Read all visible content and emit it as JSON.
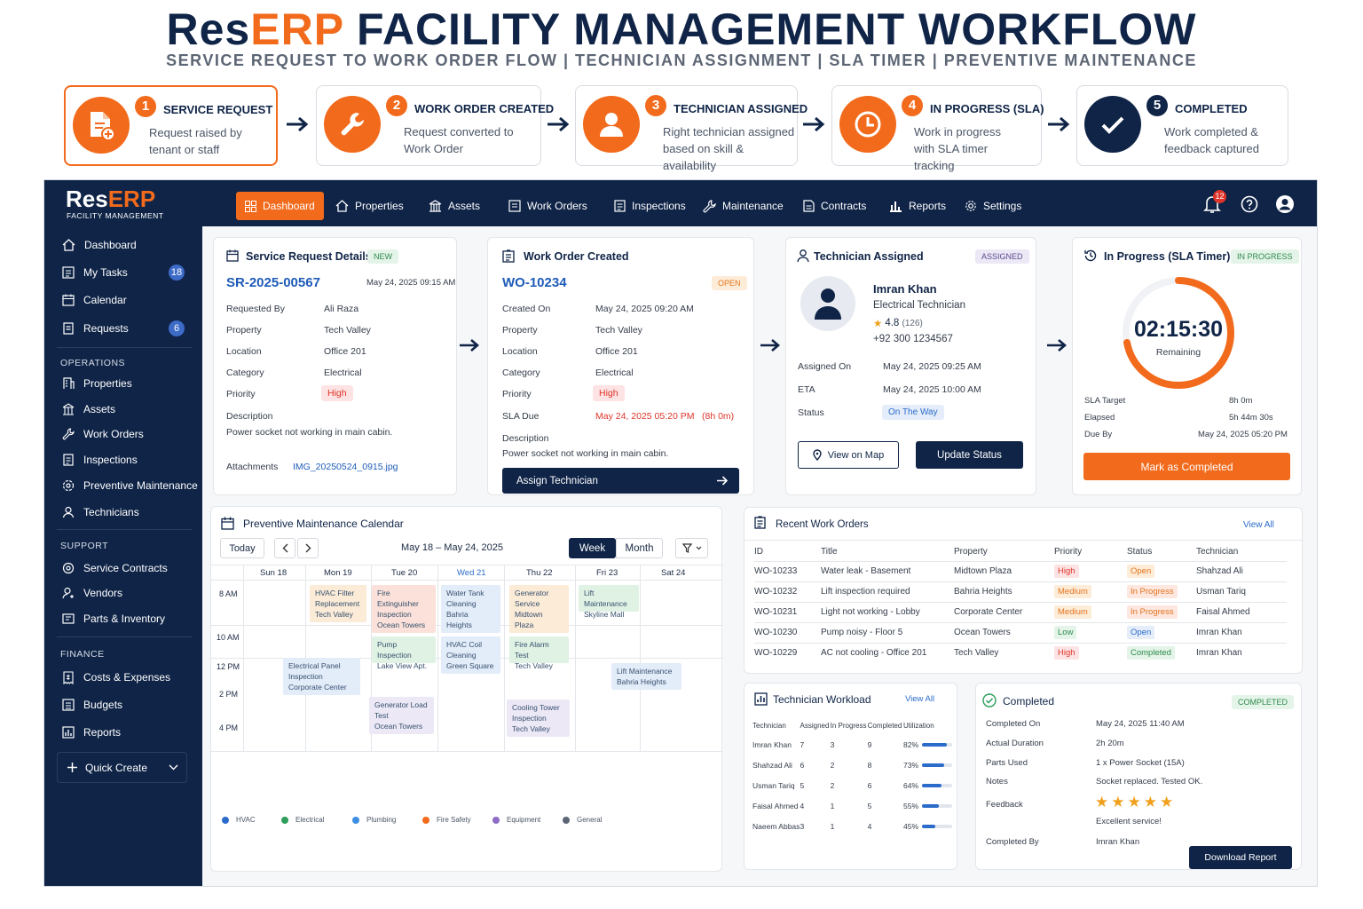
{
  "header": {
    "brand_a": "Res",
    "brand_b": "ERP",
    "title_rest": " FACILITY MANAGEMENT WORKFLOW",
    "subtitle": "SERVICE REQUEST TO WORK ORDER FLOW  |  TECHNICIAN ASSIGNMENT  |  SLA TIMER  |  PREVENTIVE MAINTENANCE"
  },
  "steps": [
    {
      "num": "1",
      "title": "SERVICE REQUEST",
      "desc": "Request raised by tenant or staff",
      "icon": "document-plus-icon"
    },
    {
      "num": "2",
      "title": "WORK ORDER CREATED",
      "desc": "Request converted to Work Order",
      "icon": "wrench-icon"
    },
    {
      "num": "3",
      "title": "TECHNICIAN ASSIGNED",
      "desc": "Right technician assigned based on skill & availability",
      "icon": "person-icon"
    },
    {
      "num": "4",
      "title": "IN PROGRESS (SLA)",
      "desc": "Work in progress with SLA timer tracking",
      "icon": "clock-icon"
    },
    {
      "num": "5",
      "title": "COMPLETED",
      "desc": "Work completed & feedback captured",
      "icon": "check-icon"
    }
  ],
  "app": {
    "logo_a": "Res",
    "logo_b": "ERP",
    "logo_sub": "FACILITY MANAGEMENT",
    "nav": [
      "Dashboard",
      "Properties",
      "Assets",
      "Work Orders",
      "Inspections",
      "Maintenance",
      "Contracts",
      "Reports",
      "Settings"
    ],
    "notif_count": "12",
    "sidebar": {
      "main": [
        {
          "label": "Dashboard"
        },
        {
          "label": "My Tasks",
          "badge": "18"
        },
        {
          "label": "Calendar"
        },
        {
          "label": "Requests",
          "badge": "6"
        }
      ],
      "operations_head": "OPERATIONS",
      "operations": [
        "Properties",
        "Assets",
        "Work Orders",
        "Inspections",
        "Preventive Maintenance",
        "Technicians"
      ],
      "support_head": "SUPPORT",
      "support": [
        "Service Contracts",
        "Vendors",
        "Parts & Inventory"
      ],
      "finance_head": "FINANCE",
      "finance": [
        "Costs & Expenses",
        "Budgets",
        "Reports"
      ],
      "quick_create": "Quick Create"
    }
  },
  "service_request": {
    "title": "Service Request Details",
    "tag": "NEW",
    "id": "SR-2025-00567",
    "date": "May 24, 2025 09:15 AM",
    "rows": [
      [
        "Requested By",
        "Ali Raza"
      ],
      [
        "Property",
        "Tech Valley"
      ],
      [
        "Location",
        "Office 201"
      ],
      [
        "Category",
        "Electrical"
      ],
      [
        "Priority",
        "High"
      ]
    ],
    "desc_label": "Description",
    "desc": "Power socket not working in main cabin.",
    "attach_label": "Attachments",
    "attach": "IMG_20250524_0915.jpg"
  },
  "work_order": {
    "title": "Work Order Created",
    "tag": "OPEN",
    "id": "WO-10234",
    "rows": [
      [
        "Created On",
        "May 24, 2025 09:20 AM"
      ],
      [
        "Property",
        "Tech Valley"
      ],
      [
        "Location",
        "Office 201"
      ],
      [
        "Category",
        "Electrical"
      ],
      [
        "Priority",
        "High"
      ]
    ],
    "sla_label": "SLA Due",
    "sla_value": "May 24, 2025 05:20 PM",
    "sla_hint": "(8h 0m)",
    "desc_label": "Description",
    "desc": "Power socket not working in main cabin.",
    "button": "Assign Technician"
  },
  "technician": {
    "title": "Technician Assigned",
    "tag": "ASSIGNED",
    "name": "Imran Khan",
    "role": "Electrical Technician",
    "rating": "4.8",
    "reviews": "(126)",
    "phone": "+92 300 1234567",
    "rows": [
      [
        "Assigned On",
        "May 24, 2025 09:25 AM"
      ],
      [
        "ETA",
        "May 24, 2025 10:00 AM"
      ]
    ],
    "status_label": "Status",
    "status": "On The Way",
    "btn_map": "View on Map",
    "btn_update": "Update Status"
  },
  "sla": {
    "title": "In Progress (SLA Timer)",
    "tag": "IN PROGRESS",
    "timer": "02:15:30",
    "timer_sub": "Remaining",
    "progress": 0.72,
    "rows": [
      [
        "SLA Target",
        "8h 0m"
      ],
      [
        "Elapsed",
        "5h 44m 30s"
      ],
      [
        "Due By",
        "May 24, 2025 05:20 PM"
      ]
    ],
    "button": "Mark as Completed"
  },
  "calendar": {
    "title": "Preventive Maintenance Calendar",
    "today": "Today",
    "range": "May 18 – May 24, 2025",
    "week": "Week",
    "month": "Month",
    "days": [
      "Sun 18",
      "Mon 19",
      "Tue 20",
      "Wed 21",
      "Thu 22",
      "Fri 23",
      "Sat 24"
    ],
    "times": [
      "8 AM",
      "10 AM",
      "12 PM",
      "2 PM",
      "4 PM"
    ],
    "events": [
      {
        "t1": "HVAC Filter",
        "t2": "Replacement",
        "t3": "Tech Valley"
      },
      {
        "t1": "Fire Extinguisher",
        "t2": "Inspection",
        "t3": "Ocean Towers"
      },
      {
        "t1": "Water Tank",
        "t2": "Cleaning",
        "t3": "Bahria Heights"
      },
      {
        "t1": "Generator",
        "t2": "Service",
        "t3": "Midtown Plaza"
      },
      {
        "t1": "Lift Maintenance",
        "t2": "Skyline Mall",
        "t3": ""
      },
      {
        "t1": "Pump Inspection",
        "t2": "Lake View Apt.",
        "t3": ""
      },
      {
        "t1": "HVAC Coil",
        "t2": "Cleaning",
        "t3": "Green Square"
      },
      {
        "t1": "Fire Alarm Test",
        "t2": "Tech Valley",
        "t3": ""
      },
      {
        "t1": "Electrical Panel",
        "t2": "Inspection",
        "t3": "Corporate Center"
      },
      {
        "t1": "Lift Maintenance",
        "t2": "Bahria Heights",
        "t3": ""
      },
      {
        "t1": "Generator Load",
        "t2": "Test",
        "t3": "Ocean Towers"
      },
      {
        "t1": "Cooling Tower",
        "t2": "Inspection",
        "t3": "Tech Valley"
      }
    ],
    "legend": [
      {
        "label": "HVAC",
        "color": "#2b6ccb"
      },
      {
        "label": "Electrical",
        "color": "#2e9e5b"
      },
      {
        "label": "Plumbing",
        "color": "#3d8ee0"
      },
      {
        "label": "Fire Safety",
        "color": "#f26a1b"
      },
      {
        "label": "Equipment",
        "color": "#8e6cc8"
      },
      {
        "label": "General",
        "color": "#5d6675"
      }
    ]
  },
  "recent": {
    "title": "Recent Work Orders",
    "view_all": "View All",
    "cols": [
      "ID",
      "Title",
      "Property",
      "Priority",
      "Status",
      "Technician"
    ],
    "rows": [
      [
        "WO-10233",
        "Water leak - Basement",
        "Midtown Plaza",
        "High",
        "Open",
        "Shahzad Ali"
      ],
      [
        "WO-10232",
        "Lift inspection required",
        "Bahria Heights",
        "Medium",
        "In Progress",
        "Usman Tariq"
      ],
      [
        "WO-10231",
        "Light not working - Lobby",
        "Corporate Center",
        "Medium",
        "In Progress",
        "Faisal Ahmed"
      ],
      [
        "WO-10230",
        "Pump noisy - Floor 5",
        "Ocean Towers",
        "Low",
        "Open",
        "Imran Khan"
      ],
      [
        "WO-10229",
        "AC not cooling - Office 201",
        "Tech Valley",
        "High",
        "Completed",
        "Imran Khan"
      ]
    ]
  },
  "workload": {
    "title": "Technician Workload",
    "view_all": "View All",
    "cols": [
      "Technician",
      "Assigned",
      "In Progress",
      "Completed",
      "Utilization"
    ],
    "rows": [
      [
        "Imran Khan",
        "7",
        "3",
        "9",
        "82%",
        0.82
      ],
      [
        "Shahzad Ali",
        "6",
        "2",
        "8",
        "73%",
        0.73
      ],
      [
        "Usman Tariq",
        "5",
        "2",
        "6",
        "64%",
        0.64
      ],
      [
        "Faisal Ahmed",
        "4",
        "1",
        "5",
        "55%",
        0.55
      ],
      [
        "Naeem Abbas",
        "3",
        "1",
        "4",
        "45%",
        0.45
      ]
    ]
  },
  "completed": {
    "title": "Completed",
    "tag": "COMPLETED",
    "rows": [
      [
        "Completed On",
        "May 24, 2025 11:40 AM"
      ],
      [
        "Actual Duration",
        "2h 20m"
      ],
      [
        "Parts Used",
        "1 x Power Socket (15A)"
      ],
      [
        "Notes",
        "Socket replaced. Tested OK."
      ]
    ],
    "feedback_label": "Feedback",
    "stars": 5,
    "feedback": "Excellent service!",
    "by_label": "Completed By",
    "by": "Imran Khan",
    "button": "Download Report"
  }
}
